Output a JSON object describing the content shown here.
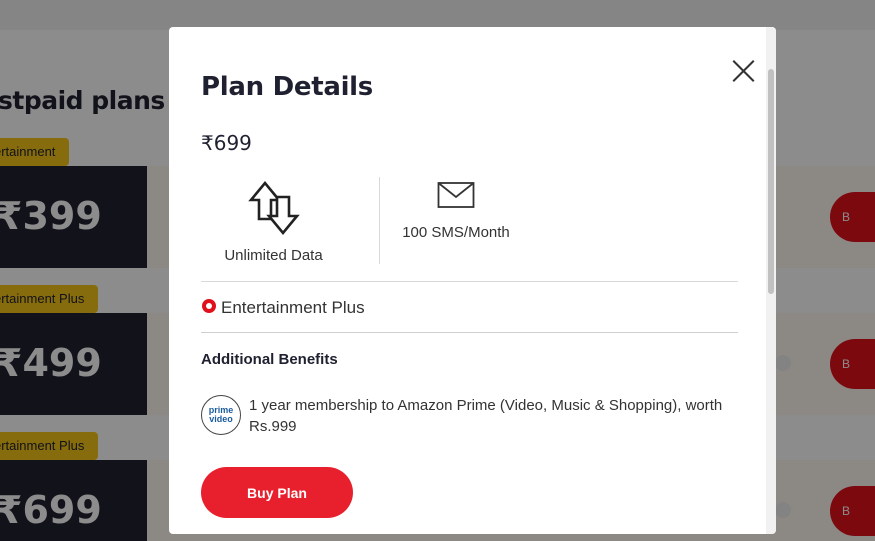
{
  "background": {
    "section_title": "stpaid plans",
    "plans": [
      {
        "tag": "ertainment",
        "price": "₹399",
        "buy_label": "B"
      },
      {
        "tag": "ertainment Plus",
        "price": "₹499",
        "buy_label": "B"
      },
      {
        "tag": "ertainment Plus",
        "price": "₹699",
        "buy_label": "B"
      }
    ]
  },
  "modal": {
    "title": "Plan Details",
    "price": "₹699",
    "features": [
      {
        "icon": "data-transfer-arrows-icon",
        "label": "Unlimited Data"
      },
      {
        "icon": "envelope-icon",
        "label": "100 SMS/Month"
      }
    ],
    "entertainment": {
      "icon": "entertainment-badge-icon",
      "label": "Entertainment Plus"
    },
    "additional_benefits": {
      "title": "Additional Benefits",
      "items": [
        {
          "logo_line1": "prime",
          "logo_line2": "video",
          "text": "1 year membership to Amazon Prime (Video, Music & Shopping), worth Rs.999"
        }
      ]
    },
    "buy_button": "Buy Plan"
  },
  "colors": {
    "accent": "#e8202d",
    "dark": "#1f2130",
    "tag_yellow": "#f5c518"
  }
}
